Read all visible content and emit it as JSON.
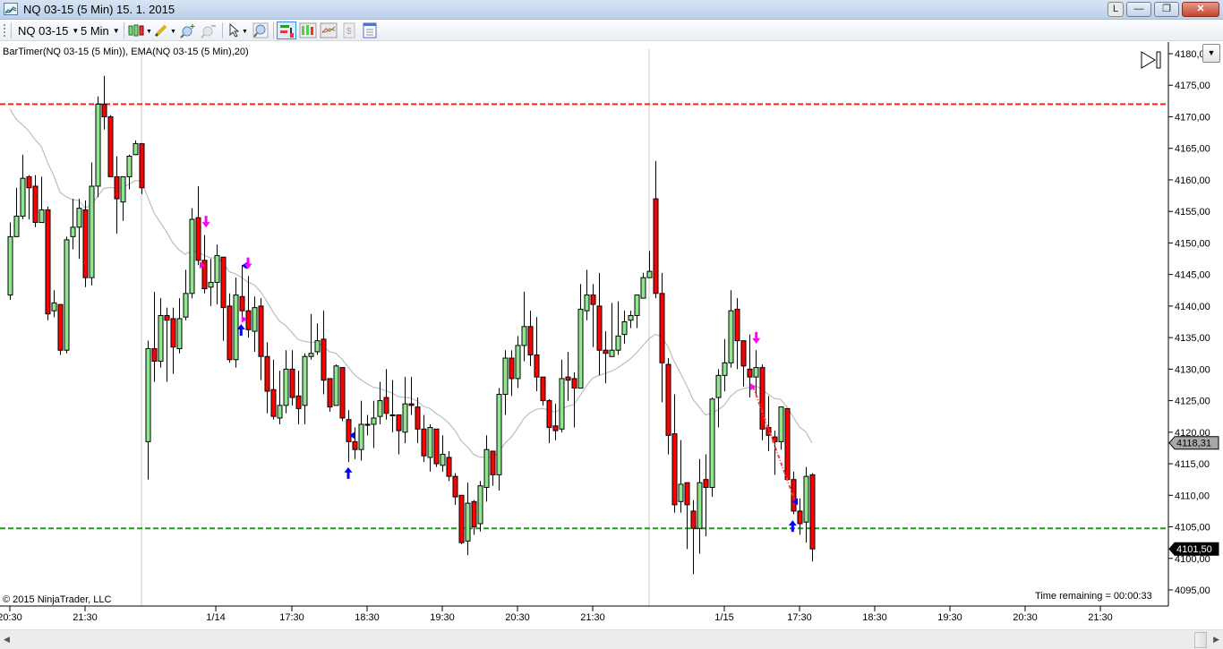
{
  "window": {
    "title": "NQ 03-15 (5 Min)  15. 1. 2015",
    "l_button": "L",
    "min": "—",
    "max": "❐",
    "close": "✕"
  },
  "toolbar": {
    "instrument": "NQ 03-15",
    "interval": "5 Min"
  },
  "chart_header": {
    "indicators": "BarTimer(NQ 03-15 (5 Min)), EMA(NQ 03-15 (5 Min),20)"
  },
  "footer": {
    "copyright": "© 2015 NinjaTrader, LLC",
    "time_remaining": "Time remaining = 00:00:33"
  },
  "chart_data": {
    "type": "candlestick",
    "title": "NQ 03-15 (5 Min)",
    "colors": {
      "up": "#8fe88f",
      "down": "#ff0000",
      "ema": "#bdbdbd",
      "resistance": "#ff2020",
      "support": "#1e9a1e",
      "signal_short": "#ff00ff",
      "signal_long": "#0000ff"
    },
    "ylim": [
      4093,
      4181.5
    ],
    "y_ticks": [
      {
        "value": 4180,
        "label": "4180,00"
      },
      {
        "value": 4175,
        "label": "4175,00"
      },
      {
        "value": 4170,
        "label": "4170,00"
      },
      {
        "value": 4165,
        "label": "4165,00"
      },
      {
        "value": 4160,
        "label": "4160,00"
      },
      {
        "value": 4155,
        "label": "4155,00"
      },
      {
        "value": 4150,
        "label": "4150,00"
      },
      {
        "value": 4145,
        "label": "4145,00"
      },
      {
        "value": 4140,
        "label": "4140,00"
      },
      {
        "value": 4135,
        "label": "4135,00"
      },
      {
        "value": 4130,
        "label": "4130,00"
      },
      {
        "value": 4125,
        "label": "4125,00"
      },
      {
        "value": 4120,
        "label": "4120,00"
      },
      {
        "value": 4115,
        "label": "4115,00"
      },
      {
        "value": 4110,
        "label": "4110,00"
      },
      {
        "value": 4105,
        "label": "4105,00"
      },
      {
        "value": 4100,
        "label": "4100,00"
      },
      {
        "value": 4095,
        "label": "4095,00"
      }
    ],
    "x_ticks": [
      {
        "bar": 0,
        "label": "20:30"
      },
      {
        "bar": 12,
        "label": "21:30"
      },
      {
        "bar": 32.86,
        "label": "1/14"
      },
      {
        "bar": 45,
        "label": "17:30"
      },
      {
        "bar": 57,
        "label": "18:30"
      },
      {
        "bar": 69,
        "label": "19:30"
      },
      {
        "bar": 81,
        "label": "20:30"
      },
      {
        "bar": 93,
        "label": "21:30"
      },
      {
        "bar": 114,
        "label": "1/15"
      },
      {
        "bar": 126,
        "label": "17:30"
      },
      {
        "bar": 138,
        "label": "18:30"
      },
      {
        "bar": 150,
        "label": "19:30"
      },
      {
        "bar": 162,
        "label": "20:30"
      },
      {
        "bar": 174,
        "label": "21:30"
      }
    ],
    "session_breaks": [
      21,
      102
    ],
    "horizontal_lines": [
      {
        "name": "resistance",
        "price": 4172.0
      },
      {
        "name": "support",
        "price": 4104.75
      }
    ],
    "ema": {
      "period": 20,
      "start_value": 4171.25
    },
    "price_labels": [
      {
        "name": "ema-last",
        "price": 4118.31,
        "label": "4118,31"
      },
      {
        "name": "last-price",
        "price": 4101.5,
        "label": "4101,50"
      }
    ],
    "markers": [
      {
        "type": "down-arrow",
        "color": "short",
        "bar": 31.3,
        "price": 4153.3
      },
      {
        "type": "right-triangle",
        "color": "short",
        "bar": 30.7,
        "price": 4146.5
      },
      {
        "type": "left-triangle",
        "color": "long",
        "bar": 37.4,
        "price": 4146.4
      },
      {
        "type": "down-arrow",
        "color": "short",
        "bar": 38,
        "price": 4146.7
      },
      {
        "type": "right-triangle",
        "color": "short",
        "bar": 37.4,
        "price": 4137.9
      },
      {
        "type": "up-arrow",
        "color": "long",
        "bar": 36.9,
        "price": 4136.3
      },
      {
        "type": "up-arrow",
        "color": "long",
        "bar": 54,
        "price": 4113.6
      },
      {
        "type": "left-triangle",
        "color": "long",
        "bar": 54.6,
        "price": 4119.5
      },
      {
        "type": "down-arrow",
        "color": "short",
        "bar": 119.1,
        "price": 4134.9
      },
      {
        "type": "right-triangle",
        "color": "short",
        "bar": 118.6,
        "price": 4127.2
      },
      {
        "type": "left-triangle",
        "color": "long",
        "bar": 125.3,
        "price": 4109.0
      },
      {
        "type": "up-arrow",
        "color": "long",
        "bar": 124.9,
        "price": 4105.2
      }
    ],
    "trade_line": {
      "from": {
        "bar": 118.6,
        "price": 4127.2
      },
      "to": {
        "bar": 125.3,
        "price": 4109.0
      }
    },
    "ohlc": [
      [
        4141.75,
        4153.25,
        4141.0,
        4151.0
      ],
      [
        4151.0,
        4158.75,
        4151.0,
        4154.25
      ],
      [
        4154.25,
        4164.0,
        4153.75,
        4160.25
      ],
      [
        4160.5,
        4160.75,
        4153.75,
        4158.75
      ],
      [
        4159.0,
        4160.75,
        4152.5,
        4153.25
      ],
      [
        4153.25,
        4160.5,
        4153.25,
        4155.25
      ],
      [
        4155.25,
        4155.75,
        4137.75,
        4138.75
      ],
      [
        4139.25,
        4142.5,
        4138.25,
        4140.5
      ],
      [
        4140.25,
        4140.25,
        4132.25,
        4133.0
      ],
      [
        4133.0,
        4151.0,
        4132.5,
        4150.5
      ],
      [
        4151.0,
        4157.0,
        4149.0,
        4152.5
      ],
      [
        4152.5,
        4157.0,
        4147.5,
        4155.5
      ],
      [
        4155.25,
        4156.75,
        4143.0,
        4144.5
      ],
      [
        4144.5,
        4162.75,
        4143.25,
        4159.0
      ],
      [
        4159.0,
        4173.25,
        4157.25,
        4172.0
      ],
      [
        4172.0,
        4176.5,
        4168.0,
        4170.0
      ],
      [
        4170.0,
        4170.25,
        4160.5,
        4160.5
      ],
      [
        4160.5,
        4163.75,
        4151.5,
        4157.0
      ],
      [
        4156.5,
        4160.5,
        4153.5,
        4160.5
      ],
      [
        4160.5,
        4164.0,
        4158.5,
        4163.75
      ],
      [
        4164.0,
        4166.25,
        4164.0,
        4165.75
      ],
      [
        4165.75,
        4165.75,
        4157.75,
        4158.75
      ],
      [
        4118.5,
        4134.5,
        4112.5,
        4133.25
      ],
      [
        4133.25,
        4142.25,
        4128.0,
        4131.25
      ],
      [
        4131.25,
        4141.25,
        4130.25,
        4138.5
      ],
      [
        4138.5,
        4139.75,
        4128.0,
        4137.75
      ],
      [
        4138.0,
        4139.75,
        4129.25,
        4133.5
      ],
      [
        4133.25,
        4141.25,
        4132.5,
        4138.0
      ],
      [
        4138.25,
        4145.75,
        4137.75,
        4142.0
      ],
      [
        4142.0,
        4155.5,
        4141.25,
        4153.75
      ],
      [
        4154.0,
        4159.0,
        4146.5,
        4147.25
      ],
      [
        4147.25,
        4151.25,
        4142.0,
        4142.75
      ],
      [
        4143.0,
        4147.5,
        4140.0,
        4143.75
      ],
      [
        4143.75,
        4149.75,
        4140.25,
        4148.0
      ],
      [
        4147.75,
        4147.75,
        4134.5,
        4139.75
      ],
      [
        4140.0,
        4142.0,
        4131.0,
        4131.5
      ],
      [
        4131.5,
        4144.5,
        4130.25,
        4141.75
      ],
      [
        4141.5,
        4146.5,
        4137.75,
        4139.25
      ],
      [
        4139.25,
        4144.75,
        4135.0,
        4136.25
      ],
      [
        4136.0,
        4141.5,
        4132.75,
        4139.75
      ],
      [
        4140.0,
        4141.25,
        4128.25,
        4132.0
      ],
      [
        4132.0,
        4134.25,
        4123.0,
        4126.5
      ],
      [
        4126.75,
        4131.5,
        4122.0,
        4122.5
      ],
      [
        4122.25,
        4129.75,
        4121.25,
        4124.25
      ],
      [
        4124.25,
        4133.0,
        4123.0,
        4130.0
      ],
      [
        4130.0,
        4133.0,
        4124.25,
        4125.5
      ],
      [
        4125.75,
        4129.75,
        4121.25,
        4123.75
      ],
      [
        4124.25,
        4132.5,
        4121.25,
        4132.0
      ],
      [
        4132.0,
        4138.75,
        4131.5,
        4132.5
      ],
      [
        4132.75,
        4137.25,
        4132.25,
        4134.5
      ],
      [
        4134.75,
        4139.25,
        4126.0,
        4128.25
      ],
      [
        4128.5,
        4128.5,
        4123.25,
        4124.0
      ],
      [
        4124.25,
        4130.75,
        4124.25,
        4130.5
      ],
      [
        4130.25,
        4130.25,
        4121.75,
        4122.25
      ],
      [
        4122.0,
        4123.5,
        4115.25,
        4118.5
      ],
      [
        4118.5,
        4120.75,
        4115.75,
        4117.25
      ],
      [
        4117.25,
        4125.0,
        4115.5,
        4121.25
      ],
      [
        4121.25,
        4122.75,
        4119.5,
        4121.25
      ],
      [
        4121.25,
        4125.0,
        4117.5,
        4122.25
      ],
      [
        4122.5,
        4128.0,
        4121.25,
        4125.0
      ],
      [
        4125.5,
        4130.0,
        4122.0,
        4123.0
      ],
      [
        4122.75,
        4128.25,
        4120.0,
        4122.75
      ],
      [
        4122.75,
        4122.75,
        4116.5,
        4120.25
      ],
      [
        4120.0,
        4128.75,
        4118.25,
        4124.5
      ],
      [
        4124.5,
        4128.75,
        4122.75,
        4124.25
      ],
      [
        4124.0,
        4125.5,
        4118.25,
        4120.5
      ],
      [
        4120.5,
        4122.75,
        4115.25,
        4116.25
      ],
      [
        4116.0,
        4121.25,
        4113.75,
        4120.75
      ],
      [
        4120.5,
        4120.5,
        4114.5,
        4115.0
      ],
      [
        4114.75,
        4119.5,
        4113.75,
        4116.5
      ],
      [
        4116.0,
        4117.0,
        4112.25,
        4113.0
      ],
      [
        4113.0,
        4113.5,
        4108.5,
        4109.75
      ],
      [
        4110.0,
        4110.0,
        4102.25,
        4102.5
      ],
      [
        4102.75,
        4112.0,
        4100.5,
        4108.75
      ],
      [
        4109.0,
        4109.25,
        4103.75,
        4105.0
      ],
      [
        4105.5,
        4112.25,
        4104.25,
        4111.5
      ],
      [
        4111.25,
        4119.5,
        4109.0,
        4117.25
      ],
      [
        4117.0,
        4117.0,
        4111.5,
        4113.25
      ],
      [
        4113.25,
        4127.0,
        4110.75,
        4126.0
      ],
      [
        4126.0,
        4133.0,
        4122.75,
        4131.75
      ],
      [
        4131.75,
        4133.0,
        4125.75,
        4128.5
      ],
      [
        4128.5,
        4135.25,
        4127.0,
        4133.75
      ],
      [
        4133.75,
        4142.25,
        4131.25,
        4136.75
      ],
      [
        4136.75,
        4139.25,
        4130.5,
        4132.25
      ],
      [
        4132.25,
        4138.25,
        4126.5,
        4128.75
      ],
      [
        4128.75,
        4128.75,
        4124.25,
        4125.0
      ],
      [
        4125.0,
        4125.25,
        4118.25,
        4120.75
      ],
      [
        4121.0,
        4124.5,
        4118.75,
        4120.25
      ],
      [
        4120.5,
        4131.5,
        4120.0,
        4128.5
      ],
      [
        4128.75,
        4132.75,
        4125.0,
        4128.25
      ],
      [
        4128.5,
        4129.5,
        4120.75,
        4127.0
      ],
      [
        4127.0,
        4143.5,
        4127.0,
        4139.5
      ],
      [
        4139.25,
        4145.75,
        4137.75,
        4141.75
      ],
      [
        4141.75,
        4143.5,
        4133.5,
        4140.25
      ],
      [
        4140.0,
        4145.25,
        4129.0,
        4133.0
      ],
      [
        4133.0,
        4136.0,
        4127.75,
        4132.5
      ],
      [
        4132.0,
        4140.5,
        4132.0,
        4133.0
      ],
      [
        4133.0,
        4140.75,
        4132.25,
        4135.25
      ],
      [
        4135.5,
        4139.25,
        4134.0,
        4137.5
      ],
      [
        4137.75,
        4139.25,
        4136.5,
        4138.5
      ],
      [
        4138.5,
        4141.75,
        4136.5,
        4141.75
      ],
      [
        4141.25,
        4145.25,
        4141.25,
        4144.5
      ],
      [
        4144.5,
        4148.75,
        4144.5,
        4145.5
      ],
      [
        4157.0,
        4163.0,
        4141.25,
        4142.0
      ],
      [
        4142.0,
        4145.25,
        4124.75,
        4131.0
      ],
      [
        4130.75,
        4131.75,
        4116.5,
        4119.5
      ],
      [
        4119.75,
        4126.0,
        4107.25,
        4108.5
      ],
      [
        4109.0,
        4118.75,
        4107.25,
        4111.75
      ],
      [
        4112.0,
        4112.0,
        4101.5,
        4108.5
      ],
      [
        4107.5,
        4109.25,
        4097.5,
        4104.75
      ],
      [
        4104.75,
        4115.75,
        4100.75,
        4112.0
      ],
      [
        4112.5,
        4116.5,
        4103.5,
        4111.25
      ],
      [
        4111.25,
        4125.5,
        4109.75,
        4125.25
      ],
      [
        4125.5,
        4130.0,
        4120.75,
        4129.0
      ],
      [
        4129.0,
        4134.75,
        4126.5,
        4131.0
      ],
      [
        4131.0,
        4142.5,
        4130.25,
        4139.25
      ],
      [
        4139.5,
        4141.25,
        4130.0,
        4134.5
      ],
      [
        4134.5,
        4134.5,
        4127.25,
        4130.5
      ],
      [
        4130.0,
        4135.5,
        4125.5,
        4128.75
      ],
      [
        4128.75,
        4133.0,
        4125.75,
        4130.25
      ],
      [
        4130.25,
        4130.75,
        4118.75,
        4120.5
      ],
      [
        4120.75,
        4125.75,
        4117.0,
        4119.5
      ],
      [
        4119.25,
        4120.25,
        4113.25,
        4118.5
      ],
      [
        4118.5,
        4124.0,
        4117.25,
        4124.0
      ],
      [
        4123.75,
        4123.75,
        4112.5,
        4112.5
      ],
      [
        4112.5,
        4113.75,
        4107.0,
        4107.5
      ],
      [
        4107.5,
        4109.5,
        4103.75,
        4105.5
      ],
      [
        4105.75,
        4114.5,
        4102.5,
        4113.0
      ],
      [
        4113.25,
        4113.5,
        4099.5,
        4101.5
      ]
    ]
  }
}
